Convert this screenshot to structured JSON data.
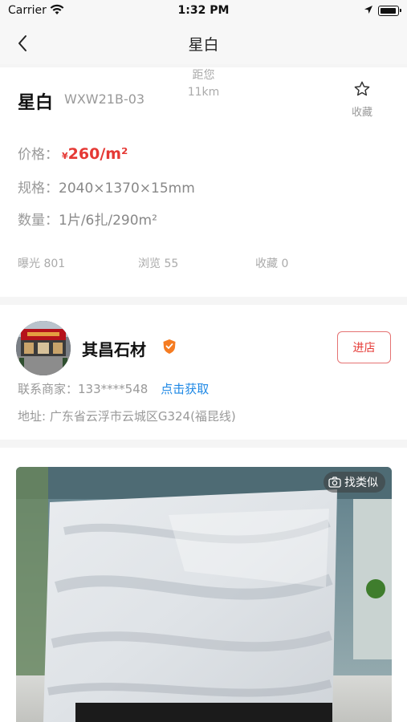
{
  "status_bar": {
    "carrier": "Carrier",
    "time": "1:32 PM"
  },
  "nav": {
    "title": "星白"
  },
  "product": {
    "name": "星白",
    "code": "WXW21B-03",
    "favorite_label": "收藏",
    "price_label": "价格：",
    "currency": "¥",
    "price": "260/m²",
    "spec_label": "规格：",
    "spec_value": "2040×1370×15mm",
    "qty_label": "数量：",
    "qty_value": "1片/6扎/290m²",
    "stats": {
      "exposure": "曝光 801",
      "views": "浏览 55",
      "favorites": "收藏 0",
      "distance_label": "距您",
      "distance_value": "11km"
    }
  },
  "store": {
    "name": "其昌石材",
    "enter_label": "进店",
    "contact_label": "联系商家：",
    "phone": "133****548",
    "get_label": "点击获取",
    "address": "地址: 广东省云浮市云城区G324(福昆线)"
  },
  "photo": {
    "find_similar_label": "找类似"
  },
  "colors": {
    "accent": "#e53935",
    "link": "#1e88e5",
    "muted": "#999999"
  }
}
